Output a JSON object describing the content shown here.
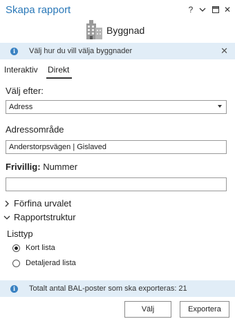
{
  "window": {
    "title": "Skapa rapport",
    "help": "?",
    "menu": "⌄",
    "restore": "⊟",
    "close": "✕"
  },
  "building": {
    "label": "Byggnad",
    "icon": "building-icon"
  },
  "info": {
    "text": "Välj hur du vill välja byggnader",
    "close": "✕",
    "icon": "info-icon"
  },
  "tabs": [
    {
      "label": "Interaktiv"
    },
    {
      "label": "Direkt",
      "active": true
    }
  ],
  "select_by": {
    "label": "Välj efter:",
    "value": "Adress"
  },
  "address_area": {
    "label": "Adressområde",
    "value": "Anderstorpsvägen | Gislaved"
  },
  "optional": {
    "prefix": "Frivillig:",
    "label": "Nummer",
    "value": ""
  },
  "refine": {
    "label": "Förfina urvalet",
    "expanded": false
  },
  "report_structure": {
    "label": "Rapportstruktur",
    "expanded": true,
    "list_type_label": "Listtyp",
    "options": [
      {
        "label": "Kort lista",
        "checked": true
      },
      {
        "label": "Detaljerad lista",
        "checked": false
      }
    ]
  },
  "status": {
    "text": "Totalt antal BAL-poster som ska exporteras: 21"
  },
  "buttons": {
    "choose": "Välj",
    "export": "Exportera"
  },
  "colors": {
    "accent": "#2a78b8",
    "info_bg": "#e1edf7",
    "info_icon": "#3a82c2"
  }
}
